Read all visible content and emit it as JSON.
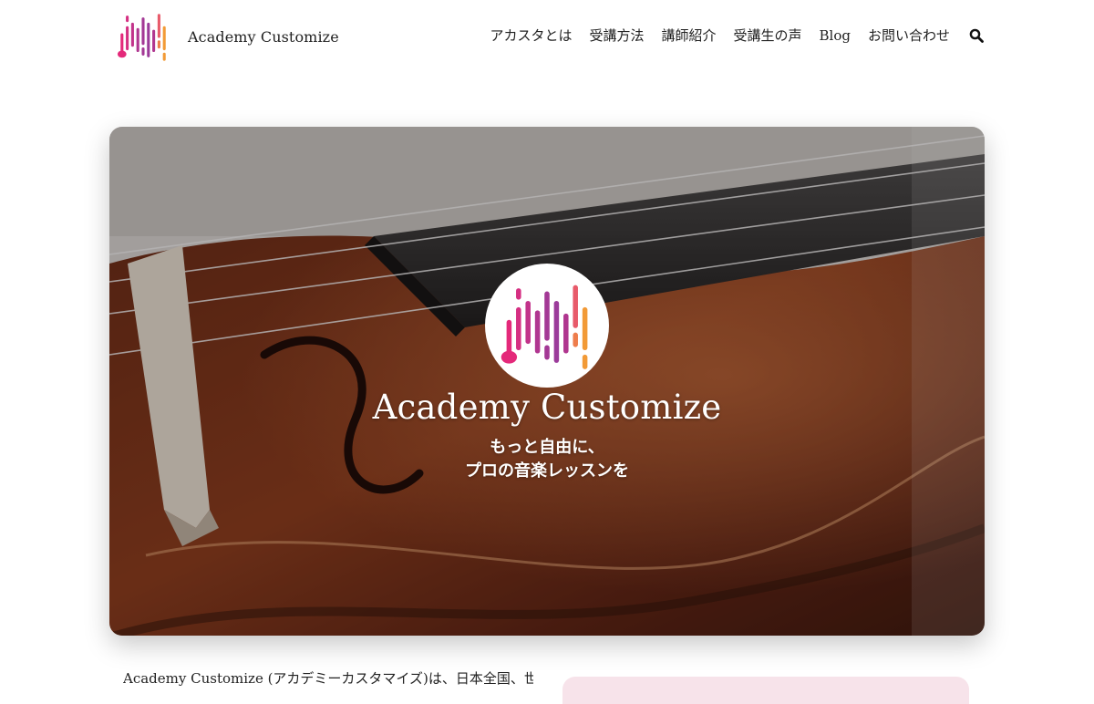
{
  "header": {
    "brand_name": "Academy Customize",
    "nav": [
      "アカスタとは",
      "受講方法",
      "講師紹介",
      "受講生の声",
      "Blog",
      "お問い合わせ"
    ],
    "search_icon": "search-icon"
  },
  "hero": {
    "title": "Academy Customize",
    "tagline_line1": "もっと自由に、",
    "tagline_line2": "プロの音楽レッスンを",
    "background": "violin close-up photo"
  },
  "intro": {
    "text": "Academy Customize (アカデミーカスタマイズ)は、日本全国、世"
  },
  "colors": {
    "logo_magenta": "#e4297a",
    "logo_purple": "#9b3b9a",
    "logo_orange": "#f29a36",
    "side_panel": "#f7e3ea",
    "text": "#222222"
  }
}
